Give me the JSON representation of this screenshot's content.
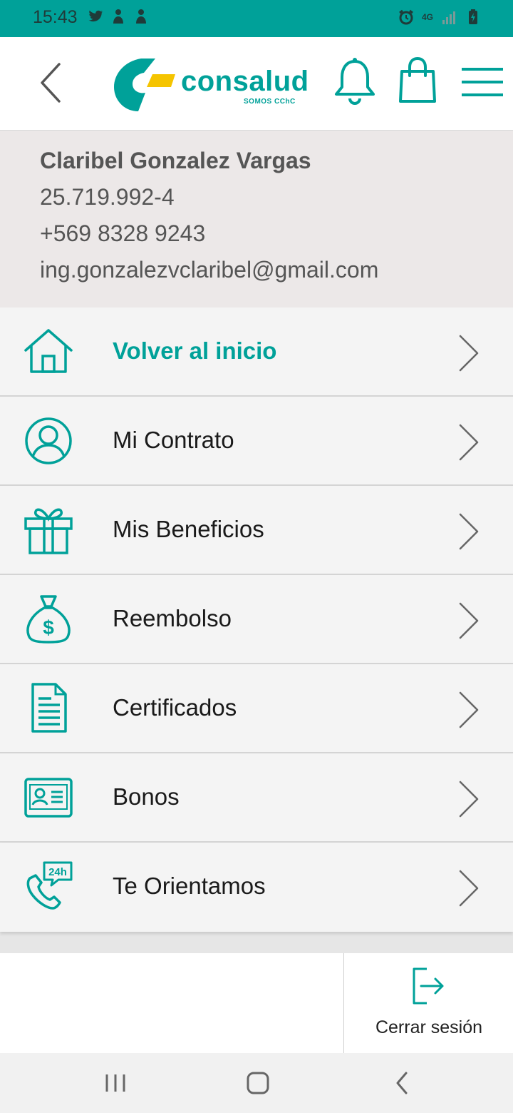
{
  "status_bar": {
    "time": "15:43",
    "left_icons": [
      "twitter-icon",
      "notification-icon",
      "notification-icon"
    ],
    "right_icons": [
      "alarm-icon",
      "4g-icon",
      "signal-icon",
      "battery-charging-icon"
    ],
    "network_label": "4G"
  },
  "header": {
    "logo_text": "consalud",
    "logo_subtitle": "SOMOS CChC",
    "brand_color": "#00a199",
    "accent_color": "#f5c400"
  },
  "profile": {
    "name": "Claribel Gonzalez Vargas",
    "rut": "25.719.992-4",
    "phone": "+569 8328 9243",
    "email": "ing.gonzalezvclaribel@gmail.com"
  },
  "menu": {
    "items": [
      {
        "label": "Volver al inicio",
        "icon": "home-icon",
        "active": true
      },
      {
        "label": "Mi Contrato",
        "icon": "user-circle-icon",
        "active": false
      },
      {
        "label": "Mis Beneficios",
        "icon": "gift-icon",
        "active": false
      },
      {
        "label": "Reembolso",
        "icon": "money-bag-icon",
        "active": false
      },
      {
        "label": "Certificados",
        "icon": "document-icon",
        "active": false
      },
      {
        "label": "Bonos",
        "icon": "id-card-icon",
        "active": false
      },
      {
        "label": "Te Orientamos",
        "icon": "phone-24h-icon",
        "active": false
      }
    ]
  },
  "footer": {
    "logout_label": "Cerrar sesión"
  }
}
